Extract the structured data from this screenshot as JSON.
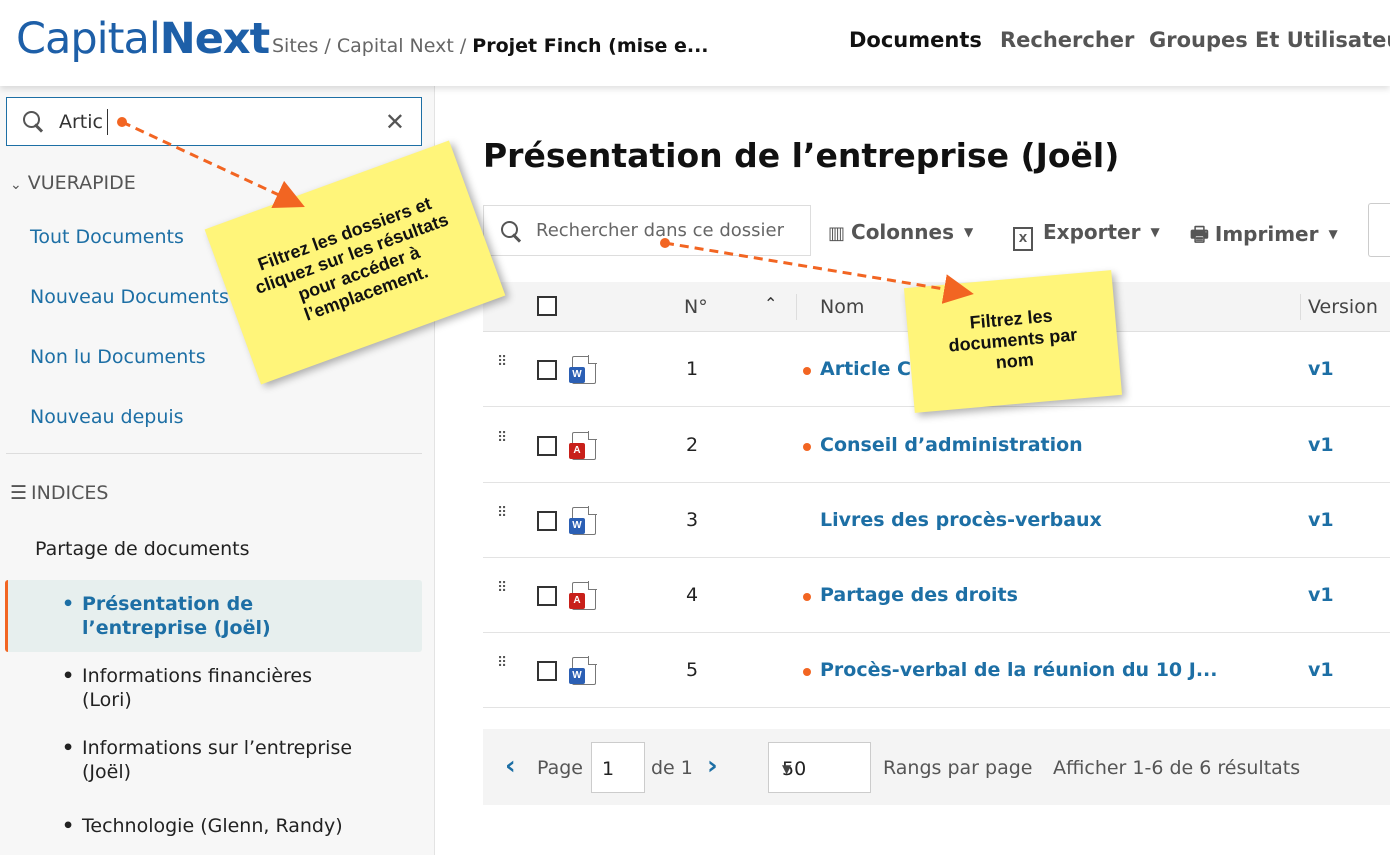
{
  "logo": {
    "part1": "Capital",
    "part2": "Next"
  },
  "breadcrumb": {
    "sites": "Sites",
    "sep1": " / ",
    "capital": "Capital Next",
    "sep2": " / ",
    "current": "Projet Finch (mise e..."
  },
  "topnav": {
    "documents": "Documents",
    "rechercher": "Rechercher",
    "groupes": "Groupes Et Utilisateur"
  },
  "sidebar": {
    "search_value": "Artic",
    "quickview_title": "VUERAPIDE",
    "quick_links": [
      "Tout Documents",
      "Nouveau Documents",
      "Non lu Documents",
      "Nouveau depuis"
    ],
    "indices_title": "INDICES",
    "tree_root": "Partage de documents",
    "tree_items": [
      {
        "line1": "Présentation de",
        "line2": "l’entreprise (Joël)"
      },
      {
        "line1": "Informations financières",
        "line2": "(Lori)"
      },
      {
        "line1": "Informations sur l’entreprise",
        "line2": "(Joël)"
      },
      {
        "line1": "Technologie (Glenn, Randy)",
        "line2": ""
      }
    ]
  },
  "main": {
    "title": "Présentation de l’entreprise (Joël)",
    "folder_search_placeholder": "Rechercher dans ce dossier",
    "toolbar": {
      "columns": "Colonnes",
      "export": "Exporter",
      "print": "Imprimer"
    }
  },
  "table": {
    "headers": {
      "num": "N°",
      "name": "Nom",
      "version": "Version"
    },
    "rows": [
      {
        "num": "1",
        "name": "Article Co",
        "version": "v1",
        "type": "word",
        "unread": true
      },
      {
        "num": "2",
        "name": "Conseil d’administration",
        "version": "v1",
        "type": "pdf",
        "unread": true
      },
      {
        "num": "3",
        "name": "Livres des procès-verbaux",
        "version": "v1",
        "type": "word",
        "unread": false
      },
      {
        "num": "4",
        "name": "Partage des droits",
        "version": "v1",
        "type": "pdf",
        "unread": true
      },
      {
        "num": "5",
        "name": "Procès-verbal de la réunion du 10 J...",
        "version": "v1",
        "type": "word",
        "unread": true
      }
    ]
  },
  "pager": {
    "page_label": "Page",
    "page_value": "1",
    "of_label": "de 1",
    "per_page_value": "50",
    "per_page_label": "Rangs par page",
    "results": "Afficher 1-6 de 6 résultats"
  },
  "notes": {
    "note1": [
      "Filtrez les dossiers et",
      "cliquez sur les résultats",
      "pour accéder à",
      "l’emplacement."
    ],
    "note2": [
      "Filtrez les",
      "documents par",
      "nom"
    ]
  },
  "colors": {
    "accent": "#f26522",
    "link": "#1d6fa5",
    "note": "#fff57a"
  }
}
